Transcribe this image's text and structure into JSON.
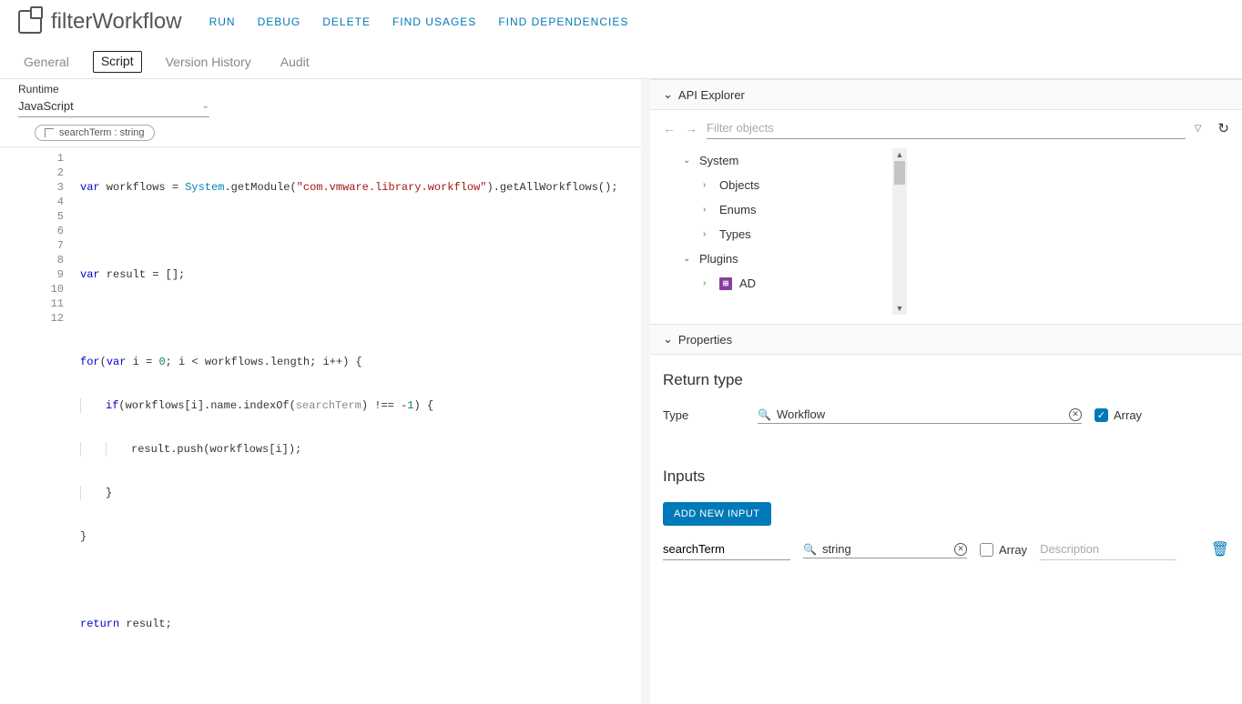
{
  "page": {
    "title": "filterWorkflow"
  },
  "actions": {
    "run": "RUN",
    "debug": "DEBUG",
    "delete": "DELETE",
    "find_usages": "FIND USAGES",
    "find_deps": "FIND DEPENDENCIES"
  },
  "tabs": {
    "general": "General",
    "script": "Script",
    "version_history": "Version History",
    "audit": "Audit"
  },
  "runtime": {
    "label": "Runtime",
    "value": "JavaScript"
  },
  "param_chip": "searchTerm : string",
  "code": {
    "line_numbers": [
      "1",
      "2",
      "3",
      "4",
      "5",
      "6",
      "7",
      "8",
      "9",
      "10",
      "11",
      "12"
    ],
    "l1_a": "var",
    "l1_b": " workflows = ",
    "l1_c": "System",
    "l1_d": ".getModule(",
    "l1_e": "\"com.vmware.library.workflow\"",
    "l1_f": ").getAllWorkflows();",
    "l3_a": "var",
    "l3_b": " result = [];",
    "l5_a": "for",
    "l5_b": "(",
    "l5_c": "var",
    "l5_d": " i = ",
    "l5_e": "0",
    "l5_f": "; i < workflows.length; i++) {",
    "l6_a": "if",
    "l6_b": "(workflows[i].name.indexOf(",
    "l6_c": "searchTerm",
    "l6_d": ") !== -",
    "l6_e": "1",
    "l6_f": ") {",
    "l7": "result.push(workflows[i]);",
    "l8": "}",
    "l9": "}",
    "l11_a": "return",
    "l11_b": " result;"
  },
  "api_explorer": {
    "title": "API Explorer",
    "filter_ph": "Filter objects",
    "tree": {
      "system": "System",
      "objects": "Objects",
      "enums": "Enums",
      "types": "Types",
      "plugins": "Plugins",
      "ad": "AD"
    }
  },
  "properties": {
    "title": "Properties",
    "return_type": "Return type",
    "type_label": "Type",
    "type_value": "Workflow",
    "array_label": "Array",
    "inputs_title": "Inputs",
    "add_btn": "ADD NEW INPUT",
    "input_name": "searchTerm",
    "input_type": "string",
    "input_array": "Array",
    "desc_ph": "Description"
  }
}
